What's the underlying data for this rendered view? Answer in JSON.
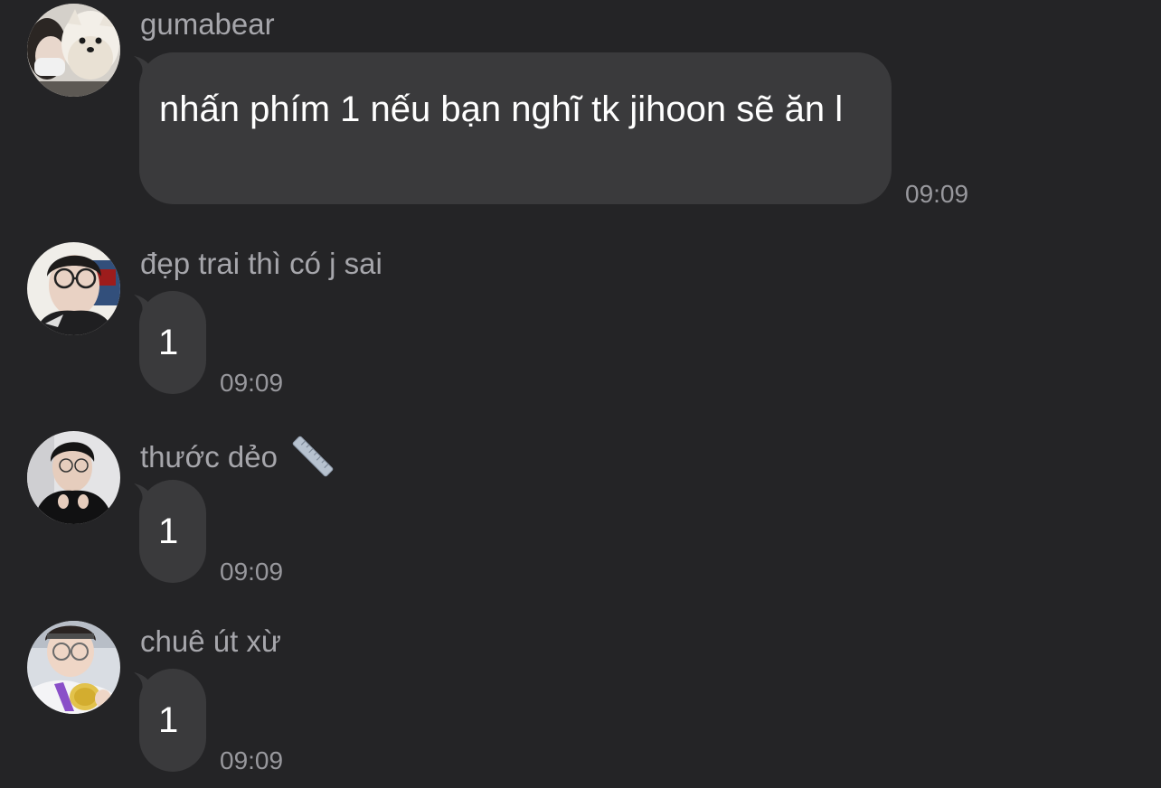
{
  "colors": {
    "background": "#242426",
    "bubble": "#3a3a3c",
    "sender_text": "#a6a6ab",
    "time_text": "#98989d",
    "message_text": "#ffffff"
  },
  "messages": [
    {
      "sender": "gumabear",
      "text": "nhấn phím 1 nếu bạn nghĩ tk jihoon sẽ ăn l",
      "time": "09:09",
      "avatar_icon": "avatar-person-with-puppy"
    },
    {
      "sender": "đẹp trai thì có j sai",
      "text": "1",
      "time": "09:09",
      "avatar_icon": "avatar-person-glasses"
    },
    {
      "sender": "thước dẻo",
      "sender_emoji_icon": "ruler-icon",
      "text": "1",
      "time": "09:09",
      "avatar_icon": "avatar-person-black-jacket"
    },
    {
      "sender": "chuê út xừ",
      "text": "1",
      "time": "09:09",
      "avatar_icon": "avatar-person-with-medal"
    }
  ]
}
